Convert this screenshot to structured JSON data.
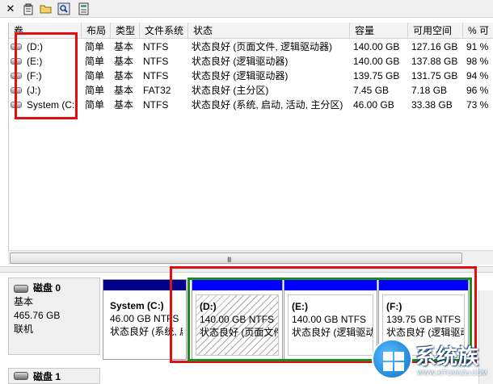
{
  "toolbar": {
    "icons": [
      "close-icon",
      "properties-icon",
      "open-folder-icon",
      "search-icon",
      "help-icon"
    ]
  },
  "columns": {
    "volume": "卷",
    "layout": "布局",
    "type": "类型",
    "filesystem": "文件系统",
    "status": "状态",
    "capacity": "容量",
    "free": "可用空间",
    "percent": "% 可"
  },
  "volumes": [
    {
      "volume": "(D:)",
      "layout": "简单",
      "type": "基本",
      "filesystem": "NTFS",
      "status": "状态良好 (页面文件, 逻辑驱动器)",
      "capacity": "140.00 GB",
      "free": "127.16 GB",
      "percent": "91 %"
    },
    {
      "volume": "(E:)",
      "layout": "简单",
      "type": "基本",
      "filesystem": "NTFS",
      "status": "状态良好 (逻辑驱动器)",
      "capacity": "140.00 GB",
      "free": "137.88 GB",
      "percent": "98 %"
    },
    {
      "volume": "(F:)",
      "layout": "简单",
      "type": "基本",
      "filesystem": "NTFS",
      "status": "状态良好 (逻辑驱动器)",
      "capacity": "139.75 GB",
      "free": "131.75 GB",
      "percent": "94 %"
    },
    {
      "volume": "(J:)",
      "layout": "简单",
      "type": "基本",
      "filesystem": "FAT32",
      "status": "状态良好 (主分区)",
      "capacity": "7.45 GB",
      "free": "7.18 GB",
      "percent": "96 %"
    },
    {
      "volume": "System (C:)",
      "layout": "简单",
      "type": "基本",
      "filesystem": "NTFS",
      "status": "状态良好 (系统, 启动, 活动, 主分区)",
      "capacity": "46.00 GB",
      "free": "33.38 GB",
      "percent": "73 %"
    }
  ],
  "scrollbar": {
    "grip": "III"
  },
  "disk0": {
    "name": "磁盘 0",
    "type": "基本",
    "size": "465.76 GB",
    "state": "联机"
  },
  "disk1": {
    "name": "磁盘 1"
  },
  "partitions": [
    {
      "name": "System  (C:)",
      "size": "46.00 GB NTFS",
      "status": "状态良好 (系统, 启",
      "bar_color": "#00008b",
      "selected": false
    },
    {
      "name": "(D:)",
      "size": "140.00 GB NTFS",
      "status": "状态良好 (页面文件",
      "bar_color": "#0000ff",
      "selected": true
    },
    {
      "name": "(E:)",
      "size": "140.00 GB NTFS",
      "status": "状态良好 (逻辑驱动",
      "bar_color": "#0000ff",
      "selected": false
    },
    {
      "name": "(F:)",
      "size": "139.75 GB NTFS",
      "status": "状态良好 (逻辑驱动",
      "bar_color": "#0000ff",
      "selected": false
    }
  ],
  "watermark": {
    "text": "系统族",
    "url": "WWW.XITONGZU.COM"
  },
  "colors": {
    "annotation_red": "#e01010",
    "annotation_green": "#1e8b1e",
    "primary_bar": "#00008b",
    "logical_bar": "#0000ff"
  }
}
